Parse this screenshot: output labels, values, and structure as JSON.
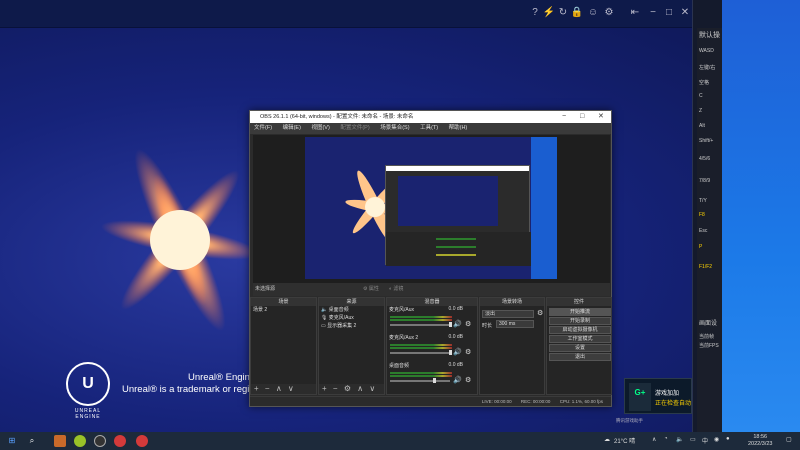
{
  "desktop": {
    "ue_line1": "Unreal® Engine, C",
    "ue_line2": "Unreal® is a trademark or registered",
    "ue_brand": "UNREAL ENGINE",
    "top_icons": [
      "help-icon",
      "flash-icon",
      "refresh-icon",
      "lock-icon",
      "face-icon",
      "settings-icon",
      "back-icon",
      "minimize-icon",
      "maximize-icon",
      "close-icon"
    ]
  },
  "side_panel": {
    "title": "默认操",
    "items": [
      "WASD",
      "左键/右",
      "空格",
      "C",
      "Z",
      "Alt",
      "Shift/+",
      "4/5/6",
      "7/8/9",
      "T/Y",
      "F8",
      "Esc",
      "P",
      "F1/F2",
      "画面设",
      "当前帧",
      "当前FPS"
    ]
  },
  "obs": {
    "title": "OBS 26.1.1 (64-bit, windows) - 配置文件: 未命名 - 场景: 未命名",
    "menu": [
      "文件(F)",
      "编辑(E)",
      "视图(V)",
      "配置文件(P)",
      "场景集合(S)",
      "工具(T)",
      "帮助(H)"
    ],
    "no_source": "未选择源",
    "ctrl_props": "属性",
    "ctrl_filters": "滤镜",
    "docks": {
      "scenes": {
        "title": "场景",
        "items": [
          "场景 2"
        ]
      },
      "sources": {
        "title": "来源",
        "items": [
          "桌面音频",
          "麦克风/Aux",
          "显示器采集 2"
        ]
      },
      "mixer": {
        "title": "混音器",
        "channels": [
          {
            "name": "麦克风/Aux",
            "level": "0.0 dB"
          },
          {
            "name": "麦克风/Aux 2",
            "level": "0.0 dB"
          },
          {
            "name": "桌面音频",
            "level": "0.0 dB"
          }
        ]
      },
      "transitions": {
        "title": "场景转场",
        "type": "淡出",
        "duration_label": "时长",
        "duration": "300 ms"
      },
      "controls": {
        "title": "控件",
        "buttons": [
          "开始推流",
          "开始录制",
          "启动虚拟摄像机",
          "工作室模式",
          "设置",
          "退出"
        ]
      }
    },
    "status": {
      "live": "LIVE: 00:00:00",
      "rec": "REC: 00:00:00",
      "cpu": "CPU: 1.1%, 60.00 fps"
    }
  },
  "notification": {
    "line1": "游戏加加",
    "line2": "正在检查自动",
    "badge": "G+"
  },
  "watermark": "腾讯游戏助手",
  "taskbar": {
    "weather": "21°C 晴",
    "lang": "中",
    "time": "18:56",
    "date": "2022/3/23"
  }
}
